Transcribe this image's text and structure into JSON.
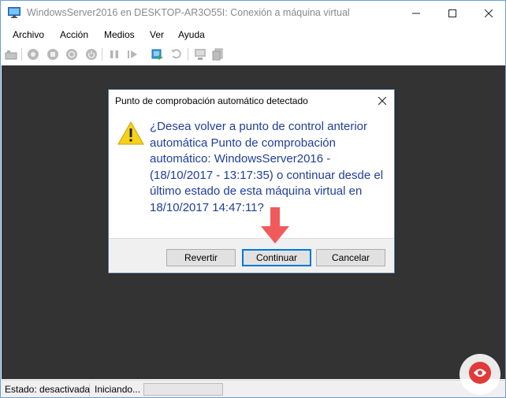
{
  "window": {
    "title": "WindowsServer2016 en DESKTOP-AR3O55I: Conexión a máquina virtual",
    "app_icon": "vm-connection-icon",
    "controls": [
      "minimize-icon",
      "maximize-icon",
      "close-icon"
    ]
  },
  "menu": {
    "items": [
      "Archivo",
      "Acción",
      "Medios",
      "Ver",
      "Ayuda"
    ]
  },
  "toolbar": {
    "icons": [
      "ctrl-alt-del-icon",
      "start-icon",
      "turn-off-icon",
      "shut-down-icon",
      "power-icon",
      "pause-icon",
      "reset-icon",
      "checkpoint-icon",
      "revert-icon",
      "enhanced-session-icon",
      "share-icon"
    ]
  },
  "dialog": {
    "title": "Punto de comprobación automático detectado",
    "message": "¿Desea volver a punto de control anterior automática Punto de comprobación automático: WindowsServer2016 - (18/10/2017 - 13:17:35) o continuar desde el último estado de esta máquina virtual en 18/10/2017 14:47:11?",
    "buttons": {
      "revertir": "Revertir",
      "continuar": "Continuar",
      "cancelar": "Cancelar"
    },
    "icon": "warning-icon"
  },
  "status": {
    "estado": "Estado: desactivada",
    "progress_label": "Iniciando..."
  },
  "colors": {
    "screen_bg": "#333333",
    "message_text": "#1f3f9a",
    "annotation_arrow": "#f15a5a",
    "default_button_border": "#0078d7"
  }
}
